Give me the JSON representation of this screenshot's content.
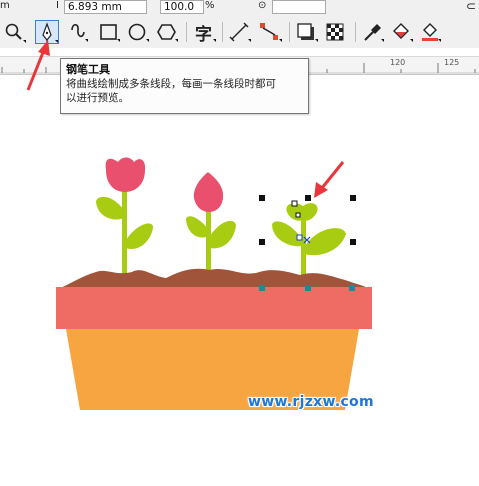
{
  "property_bar": {
    "unit_fragment": "m",
    "height_value": "6.893 mm",
    "scale_value": "100.0",
    "scale_unit": "%"
  },
  "toolbar": {
    "tools": [
      {
        "name": "zoom-tool",
        "icon": "magnifier-icon"
      },
      {
        "name": "pen-tool",
        "icon": "pen-nib-icon",
        "selected": true
      },
      {
        "name": "freehand-tool",
        "icon": "curve-icon"
      },
      {
        "name": "rectangle-tool",
        "icon": "rectangle-icon"
      },
      {
        "name": "ellipse-tool",
        "icon": "ellipse-icon"
      },
      {
        "name": "polygon-tool",
        "icon": "hexagon-icon"
      },
      {
        "name": "text-tool",
        "icon": "text-icon",
        "glyph": "字"
      },
      {
        "name": "parallel-dimension-tool",
        "icon": "dimension-icon"
      },
      {
        "name": "connector-tool",
        "icon": "connector-icon"
      },
      {
        "name": "drop-shadow-tool",
        "icon": "drop-shadow-icon"
      },
      {
        "name": "transparency-tool",
        "icon": "checkerboard-icon"
      },
      {
        "name": "eyedropper-tool",
        "icon": "eyedropper-icon"
      },
      {
        "name": "interactive-fill-tool",
        "icon": "fill-bucket-icon"
      },
      {
        "name": "smart-fill-tool",
        "icon": "smart-fill-icon"
      }
    ]
  },
  "ruler": {
    "labels": [
      "120",
      "125"
    ]
  },
  "tooltip": {
    "title": "钢笔工具",
    "description_line1": "将曲线绘制成多条线段，每画一条线段时都可",
    "description_line2": "以进行预览。"
  },
  "watermark": {
    "text": "www.rjzxw.com"
  },
  "colors": {
    "panel_bg": "#f0f0f0",
    "selection_blue": "#3f7fd8",
    "annotation_arrow": "#e8373a",
    "flower_pink": "#e8506d",
    "leaf_green": "#a8cc12",
    "soil_brown": "#a0553a",
    "pot_rim": "#ef6c64",
    "pot_body": "#f7a540",
    "node_teal": "#1a8c97"
  }
}
